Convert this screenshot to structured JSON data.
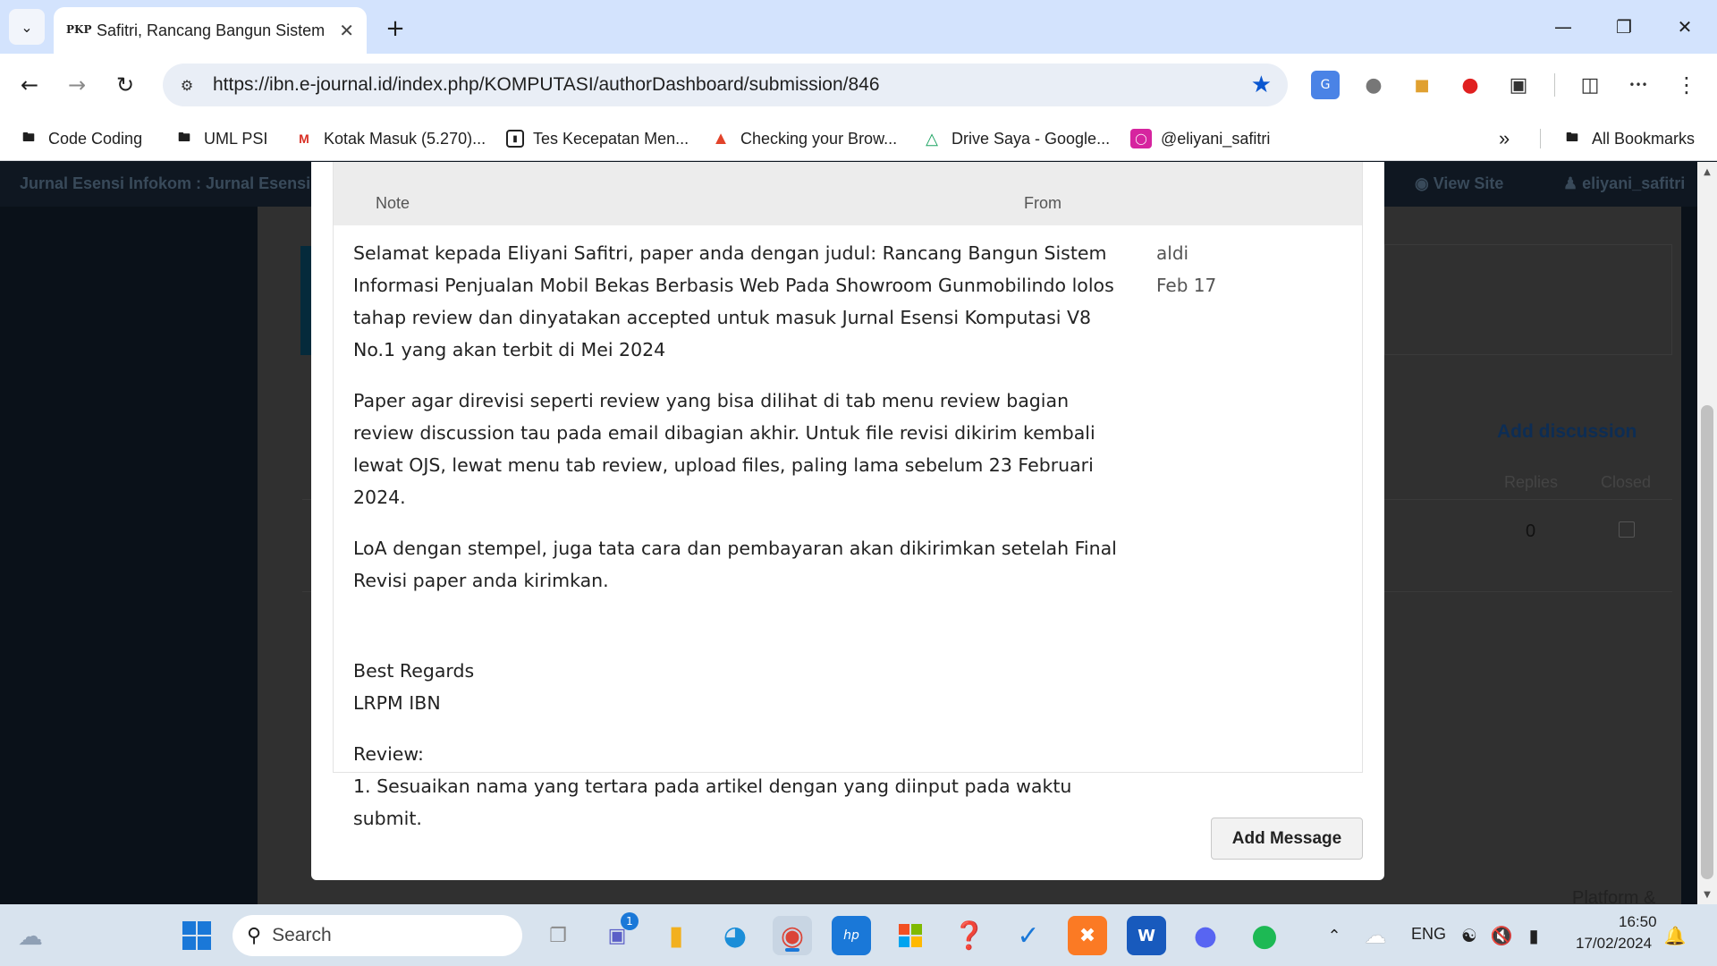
{
  "browser": {
    "tab_title": "Safitri, Rancang Bangun Sistem",
    "tab_favicon": "PKP",
    "url": "https://ibn.e-journal.id/index.php/KOMPUTASI/authorDashboard/submission/846",
    "bookmarks": [
      {
        "label": "Code Coding",
        "icon": "folder-icon"
      },
      {
        "label": "UML PSI",
        "icon": "folder-icon"
      },
      {
        "label": "Kotak Masuk (5.270)...",
        "icon": "gmail-icon"
      },
      {
        "label": "Tes Kecepatan Men...",
        "icon": "speedtest-icon"
      },
      {
        "label": "Checking your Brow...",
        "icon": "gitlab-icon"
      },
      {
        "label": "Drive Saya - Google...",
        "icon": "google-drive-icon"
      },
      {
        "label": "@eliyani_safitri",
        "icon": "instagram-icon"
      }
    ],
    "all_bookmarks": "All Bookmarks"
  },
  "ojs": {
    "site_title": "Jurnal Esensi Infokom : Jurnal Esensi",
    "view_site": "View Site",
    "user": "eliyani_safitri",
    "add_discussion": "Add discussion",
    "col_replies": "Replies",
    "col_closed": "Closed",
    "replies_value": "0",
    "footer_text": "Platform &"
  },
  "modal": {
    "col_note": "Note",
    "col_from": "From",
    "note_paragraphs": [
      "Selamat kepada Eliyani Safitri, paper anda dengan judul: Rancang Bangun Sistem Informasi Penjualan Mobil Bekas Berbasis Web Pada Showroom Gunmobilindo lolos tahap review dan dinyatakan accepted untuk masuk Jurnal Esensi Komputasi V8 No.1 yang akan terbit di Mei 2024",
      "Paper agar direvisi seperti review yang bisa dilihat di tab menu review bagian review discussion tau pada email dibagian akhir. Untuk file revisi dikirim kembali lewat OJS, lewat menu tab review, upload files, paling lama sebelum 23 Februari 2024.",
      "LoA dengan stempel, juga tata cara dan pembayaran akan dikirimkan setelah Final Revisi paper anda kirimkan."
    ],
    "regards_line1": "Best Regards",
    "regards_line2": "LRPM IBN",
    "review_label": "Review:",
    "review_item": "1. Sesuaikan nama yang tertara pada artikel dengan yang diinput pada waktu submit.",
    "from_name": "aldi",
    "from_date": "Feb 17",
    "add_message": "Add Message"
  },
  "taskbar": {
    "search_placeholder": "Search",
    "teams_badge": "1",
    "language": "ENG",
    "time": "16:50",
    "date": "17/02/2024"
  },
  "colors": {
    "tabstrip": "#d3e3fd",
    "omnibox": "#e9eef6",
    "accent_blue": "#0b57d0",
    "taskbar": "#d8e3ee"
  }
}
